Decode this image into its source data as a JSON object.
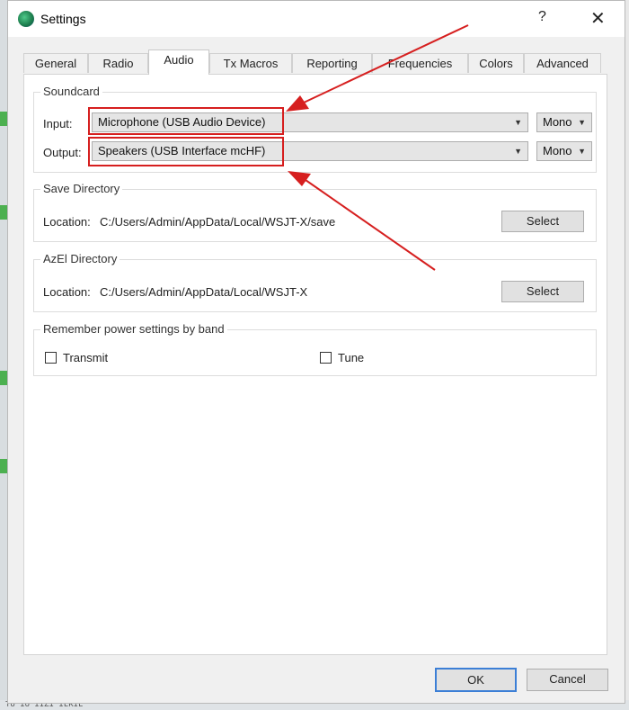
{
  "window": {
    "title": "Settings",
    "help_label": "?",
    "close_label": "✕"
  },
  "tabs": [
    {
      "label": "General",
      "active": false
    },
    {
      "label": "Radio",
      "active": false
    },
    {
      "label": "Audio",
      "active": true
    },
    {
      "label": "Tx Macros",
      "active": false
    },
    {
      "label": "Reporting",
      "active": false
    },
    {
      "label": "Frequencies",
      "active": false
    },
    {
      "label": "Colors",
      "active": false
    },
    {
      "label": "Advanced",
      "active": false
    }
  ],
  "soundcard": {
    "title": "Soundcard",
    "input_label": "Input:",
    "input_value": "Microphone (USB Audio Device)",
    "input_channel": "Mono",
    "output_label": "Output:",
    "output_value": "Speakers (USB Interface mcHF)",
    "output_channel": "Mono"
  },
  "save_directory": {
    "title": "Save Directory",
    "location_label": "Location:",
    "path": "C:/Users/Admin/AppData/Local/WSJT-X/save",
    "select_label": "Select"
  },
  "azel_directory": {
    "title": "AzEl Directory",
    "location_label": "Location:",
    "path": "C:/Users/Admin/AppData/Local/WSJT-X",
    "select_label": "Select"
  },
  "power": {
    "title": "Remember power settings by band",
    "transmit_label": "Transmit",
    "transmit_checked": false,
    "tune_label": "Tune",
    "tune_checked": false
  },
  "footer": {
    "ok_label": "OK",
    "cancel_label": "Cancel"
  },
  "background": {
    "bottom_text": "TU IU IIZI ILKIL"
  },
  "colors": {
    "annotation": "#d61f1f",
    "focus": "#3c7fd6"
  }
}
